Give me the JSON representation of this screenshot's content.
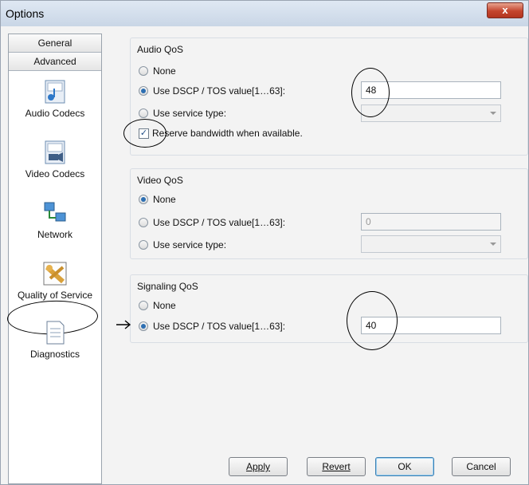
{
  "window": {
    "title": "Options",
    "close_glyph": "x"
  },
  "sidebar": {
    "tabs": [
      "General",
      "Advanced"
    ],
    "items": [
      {
        "label": "Audio Codecs",
        "icon": "audio-codecs-icon"
      },
      {
        "label": "Video Codecs",
        "icon": "video-codecs-icon"
      },
      {
        "label": "Network",
        "icon": "network-icon"
      },
      {
        "label": "Quality of Service",
        "icon": "quality-of-service-icon"
      },
      {
        "label": "Diagnostics",
        "icon": "diagnostics-icon"
      }
    ]
  },
  "audio_qos": {
    "title": "Audio QoS",
    "none_label": "None",
    "dscp_label": "Use DSCP / TOS value[1…63]:",
    "service_label": "Use service type:",
    "reserve_label": "Reserve bandwidth when available.",
    "dscp_value": "48"
  },
  "video_qos": {
    "title": "Video QoS",
    "none_label": "None",
    "dscp_label": "Use DSCP / TOS value[1…63]:",
    "service_label": "Use service type:",
    "dscp_value": "0"
  },
  "signaling_qos": {
    "title": "Signaling QoS",
    "none_label": "None",
    "dscp_label": "Use DSCP / TOS value[1…63]:",
    "dscp_value": "40"
  },
  "buttons": {
    "apply": "Apply",
    "revert": "Revert",
    "ok": "OK",
    "cancel": "Cancel"
  }
}
